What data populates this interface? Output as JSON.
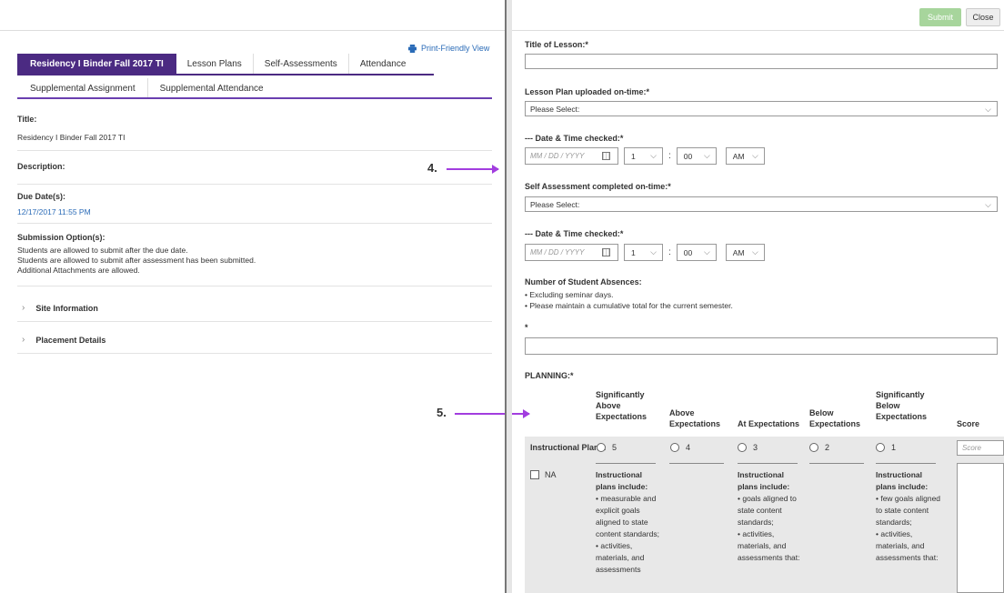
{
  "left": {
    "print_link": "Print-Friendly View",
    "tabs_row1": [
      "Residency I Binder Fall 2017 TI",
      "Lesson Plans",
      "Self-Assessments",
      "Attendance"
    ],
    "tabs_row2": [
      "Supplemental Assignment",
      "Supplemental Attendance"
    ],
    "title_label": "Title:",
    "title_value": "Residency I Binder Fall 2017 TI",
    "description_label": "Description:",
    "due_label": "Due Date(s):",
    "due_value": "12/17/2017 11:55 PM",
    "submission_label": "Submission Option(s):",
    "submission_lines": [
      "Students are allowed to submit after the due date.",
      "Students are allowed to submit after assessment has been submitted.",
      "Additional Attachments are allowed."
    ],
    "accordions": [
      "Site Information",
      "Placement Details"
    ]
  },
  "callouts": {
    "four": "4.",
    "five": "5."
  },
  "colors": {
    "tab_active": "#4b2a82",
    "submit_bg": "#a7d59c",
    "link": "#2a6bb7",
    "arrow": "#a23ddf"
  },
  "right": {
    "submit": "Submit",
    "close": "Close",
    "title_of_lesson": "Title of Lesson:*",
    "lesson_plan_on_time": "Lesson Plan uploaded on-time:*",
    "please_select": "Please Select:",
    "date_time_checked": "--- Date & Time checked:*",
    "date_placeholder": "MM / DD / YYYY",
    "hour": "1",
    "minute": "00",
    "ampm": "AM",
    "self_assessment_on_time": "Self Assessment completed on-time:*",
    "absences_label": "Number of Student Absences:",
    "absences_notes": [
      "•  Excluding seminar days.",
      "•  Please maintain a cumulative total for the current semester."
    ],
    "required_star": "*",
    "planning_label": "PLANNING:*",
    "rubric": {
      "headers": [
        "Significantly Above Expectations",
        "Above Expectations",
        "At Expectations",
        "Below Expectations",
        "Significantly Below Expectations",
        "Score"
      ],
      "row_label": "Instructional Plans:",
      "na": "NA",
      "ratings": [
        "5",
        "4",
        "3",
        "2",
        "1"
      ],
      "score_placeholder": "Score",
      "desc_5": [
        "Instructional plans include:",
        "• measurable and explicit goals aligned to state content standards;",
        "• activities, materials, and assessments"
      ],
      "desc_3": [
        "Instructional plans include:",
        "• goals aligned to state content standards;",
        "• activities, materials, and assessments that:"
      ],
      "desc_1": [
        "Instructional plans include:",
        "• few goals aligned to state content standards;",
        "• activities, materials, and assessments that:"
      ]
    }
  }
}
